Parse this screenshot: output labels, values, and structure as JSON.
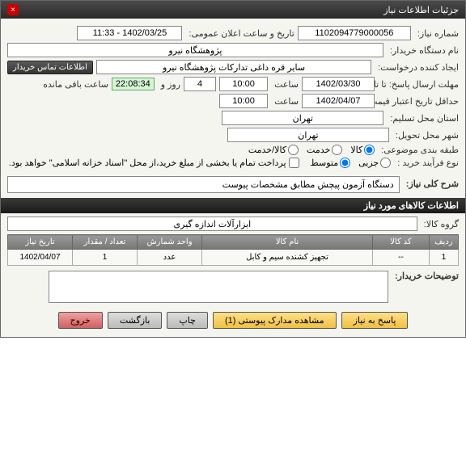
{
  "title_bar": {
    "title": "جزئیات اطلاعات نیاز"
  },
  "fields": {
    "need_no_label": "شماره نیاز:",
    "need_no": "1102094779000056",
    "announce_dt_label": "تاریخ و ساعت اعلان عمومی:",
    "announce_dt": "1402/03/25 - 11:33",
    "buyer_label": "نام دستگاه خریدار:",
    "buyer": "پژوهشگاه نیرو",
    "requester_label": "ایجاد کننده درخواست:",
    "requester": "سایر قره داغی تدارکات پژوهشگاه نیرو",
    "contact_btn": "اطلاعات تماس خریدار",
    "reply_deadline_label": "مهلت ارسال پاسخ: تا تاریخ:",
    "reply_date": "1402/03/30",
    "time_label": "ساعت",
    "reply_time": "10:00",
    "days_val": "4",
    "days_label": "روز و",
    "remain_time": "22:08:34",
    "remain_label": "ساعت باقی مانده",
    "price_valid_label": "حداقل تاریخ اعتبار قیمت: تا تاریخ:",
    "price_date": "1402/04/07",
    "price_time": "10:00",
    "province_label": "استان محل تسلیم:",
    "province": "تهران",
    "city_label": "شهر محل تحویل:",
    "city": "تهران",
    "subject_class_label": "طبقه بندی موضوعی:",
    "r_goods": "کالا",
    "r_service": "خدمت",
    "r_both": "کالا/خدمت",
    "process_label": "نوع فرآیند خرید :",
    "r_minor": "جزیی",
    "r_medium": "متوسط",
    "partial_pay": "پرداخت تمام یا بخشی از مبلغ خرید،از محل \"اسناد خزانه اسلامی\" خواهد بود.",
    "need_desc_label": "شرح کلی نیاز:",
    "need_desc": "دستگاه آزمون پیچش مطابق مشخصات پیوست",
    "goods_section": "اطلاعات کالاهای مورد نیاز",
    "goods_group_label": "گروه کالا:",
    "goods_group": "ابزارآلات اندازه گیری",
    "buyer_comments_label": "توضیحات خریدار:"
  },
  "table": {
    "headers": {
      "row": "ردیف",
      "code": "کد کالا",
      "name": "نام کالا",
      "unit": "واحد شمارش",
      "qty": "تعداد / مقدار",
      "date": "تاریخ نیاز"
    },
    "rows": [
      {
        "row": "1",
        "code": "--",
        "name": "تجهیز کشنده سیم و کابل",
        "unit": "عدد",
        "qty": "1",
        "date": "1402/04/07"
      }
    ]
  },
  "buttons": {
    "reply": "پاسخ به نیاز",
    "attachments": "مشاهده مدارک پیوستی (1)",
    "print": "چاپ",
    "back": "بازگشت",
    "exit": "خروج"
  }
}
